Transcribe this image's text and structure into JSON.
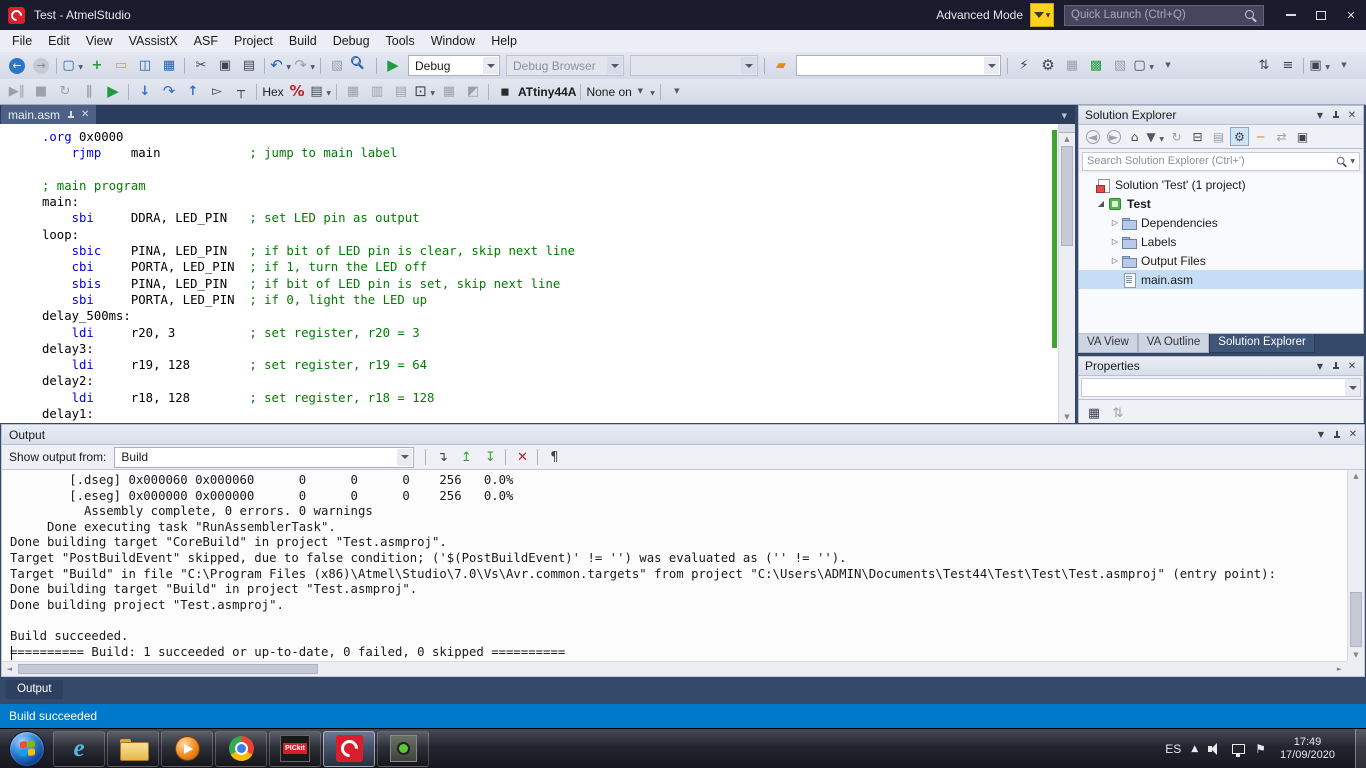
{
  "colors": {
    "statusbar_bg": "#0079CB",
    "keyword": "#0000E6",
    "comment": "#007D00",
    "selection_bg": "#C6DEF5",
    "titlebar_bg": "#1B1B2E",
    "frame_bg": "#35496B"
  },
  "icons": {
    "caret": "▼",
    "caret_up": "▲",
    "close": "✕",
    "left_arrow": "◄",
    "right_arrow": "►"
  },
  "titlebar": {
    "title": "Test - AtmelStudio",
    "advanced_mode_label": "Advanced Mode",
    "quick_launch_placeholder": "Quick Launch (Ctrl+Q)"
  },
  "menubar": {
    "items": [
      "File",
      "Edit",
      "View",
      "VAssistX",
      "ASF",
      "Project",
      "Build",
      "Debug",
      "Tools",
      "Window",
      "Help"
    ]
  },
  "toolbar_standard": {
    "group_a": [
      {
        "n": "nav-back-icon",
        "g": "←",
        "c": "circ"
      },
      {
        "n": "nav-forward-icon",
        "g": "→",
        "c": "circ dim"
      },
      {
        "n": "new-file-icon",
        "g": "▢",
        "c": "sp blue dd"
      },
      {
        "n": "add-item-icon",
        "g": "+",
        "c": "green bold"
      },
      {
        "n": "open-file-icon",
        "g": "▭",
        "c": "gold"
      },
      {
        "n": "save-icon",
        "g": "◫",
        "c": "blue"
      },
      {
        "n": "save-all-icon",
        "g": "▦",
        "c": "blue"
      },
      {
        "n": "cut-icon",
        "g": "✂",
        "c": "sp dark"
      },
      {
        "n": "copy-icon",
        "g": "▣",
        "c": "dark"
      },
      {
        "n": "paste-icon",
        "g": "▤",
        "c": "dark"
      },
      {
        "n": "undo-icon",
        "g": "↶",
        "c": "sp blue dd big"
      },
      {
        "n": "redo-icon",
        "g": "↷",
        "c": "dim dd big"
      },
      {
        "n": "navigate-icon",
        "g": "▧",
        "c": "sp dim"
      },
      {
        "n": "find-icon",
        "g": "",
        "c": "mag blue"
      },
      {
        "n": "start-debugging-icon",
        "g": "▶",
        "c": "sp green big"
      }
    ],
    "debug_config_value": "Debug",
    "debug_browser_value": "Debug Browser",
    "group_b": [
      {
        "n": "profiler-icon",
        "g": "▰",
        "c": "sp orange"
      }
    ],
    "group_c": [
      {
        "n": "device-programming-icon",
        "g": "⚡",
        "c": "sp dark"
      },
      {
        "n": "device-tools-icon",
        "g": "⚙",
        "c": "dark big"
      },
      {
        "n": "show-output-icon",
        "g": "▦",
        "c": "dim"
      },
      {
        "n": "asf-explorer-icon",
        "g": "▩",
        "c": "green"
      },
      {
        "n": "editor-settings-icon",
        "g": "▧",
        "c": "dim"
      },
      {
        "n": "window-layout-icon",
        "g": "▢",
        "c": "dark dd"
      },
      {
        "n": "toolbar-overflow-icon",
        "g": "▼",
        "c": "tiny"
      }
    ],
    "group_d": [
      {
        "n": "sort-lines-icon",
        "g": "⇅",
        "c": "dark"
      },
      {
        "n": "list-members-icon",
        "g": "≡",
        "c": "dark"
      },
      {
        "n": "float-window-icon",
        "g": "▣",
        "c": "sp dark dd"
      },
      {
        "n": "toolbar-options-icon",
        "g": "▼",
        "c": "tiny"
      }
    ]
  },
  "toolbar_debug": {
    "items": [
      {
        "n": "start-debug-break-icon",
        "g": "▶∥",
        "c": "dim"
      },
      {
        "n": "stop-debug-icon",
        "g": "■",
        "c": "dim"
      },
      {
        "n": "restart-debug-icon",
        "g": "↻",
        "c": "dim"
      },
      {
        "n": "break-all-icon",
        "g": "∥",
        "c": "dim bold"
      },
      {
        "n": "continue-icon",
        "g": "▶",
        "c": "green big"
      },
      {
        "n": "step-into-icon",
        "g": "↓",
        "c": "sp step bold"
      },
      {
        "n": "step-over-icon",
        "g": "↷",
        "c": "step big"
      },
      {
        "n": "step-out-icon",
        "g": "↑",
        "c": "step bold"
      },
      {
        "n": "run-to-cursor-icon",
        "g": "▻",
        "c": "dark"
      },
      {
        "n": "show-next-statement-icon",
        "g": "┬",
        "c": "dark"
      },
      {
        "n": "hex-toggle-button",
        "g": "Hex",
        "c": "sp txt"
      },
      {
        "n": "vassistx-icon",
        "g": "%",
        "c": "red bold big"
      },
      {
        "n": "va-options-icon",
        "g": "▤",
        "c": "dark dd"
      },
      {
        "n": "memory-window-icon",
        "g": "▦",
        "c": "sp dim"
      },
      {
        "n": "watch-window-icon",
        "g": "▥",
        "c": "dim"
      },
      {
        "n": "io-view-icon",
        "g": "▤",
        "c": "dim"
      },
      {
        "n": "device-monitor-icon",
        "g": "⊡",
        "c": "dark dd big"
      },
      {
        "n": "register-window-icon",
        "g": "▦",
        "c": "dim"
      },
      {
        "n": "disassembly-window-icon",
        "g": "◩",
        "c": "dim"
      },
      {
        "n": "device-chip-icon",
        "g": "◼",
        "c": "sp chip"
      },
      {
        "n": "device-name-button",
        "g": "ATtiny44A",
        "c": "txt bold"
      },
      {
        "n": "debug-tool-button",
        "g": "None on",
        "c": "sp txt"
      },
      {
        "n": "device-options-icon",
        "g": "▼",
        "c": "tiny dd"
      },
      {
        "n": "toolbar-overflow-icon",
        "g": "▼",
        "c": "sp tiny"
      }
    ]
  },
  "editor": {
    "tab_label": "main.asm",
    "lines": [
      [
        [
          ".org",
          "k"
        ],
        [
          " 0x0000",
          "p"
        ]
      ],
      [
        [
          "    ",
          "p"
        ],
        [
          "rjmp",
          "k"
        ],
        [
          "    main            ",
          "p"
        ],
        [
          "; jump to main label",
          "c"
        ]
      ],
      [],
      [
        [
          "; main program",
          "c"
        ]
      ],
      [
        [
          "main:",
          "p"
        ]
      ],
      [
        [
          "    ",
          "p"
        ],
        [
          "sbi",
          "k"
        ],
        [
          "     DDRA, LED_PIN   ",
          "p"
        ],
        [
          "; set LED pin as output",
          "c"
        ]
      ],
      [
        [
          "loop:",
          "p"
        ]
      ],
      [
        [
          "    ",
          "p"
        ],
        [
          "sbic",
          "k"
        ],
        [
          "    PINA, LED_PIN   ",
          "p"
        ],
        [
          "; if bit of LED pin is clear, skip next line",
          "c"
        ]
      ],
      [
        [
          "    ",
          "p"
        ],
        [
          "cbi",
          "k"
        ],
        [
          "     PORTA, LED_PIN  ",
          "p"
        ],
        [
          "; if 1, turn the LED off",
          "c"
        ]
      ],
      [
        [
          "    ",
          "p"
        ],
        [
          "sbis",
          "k"
        ],
        [
          "    PINA, LED_PIN   ",
          "p"
        ],
        [
          "; if bit of LED pin is set, skip next line",
          "c"
        ]
      ],
      [
        [
          "    ",
          "p"
        ],
        [
          "sbi",
          "k"
        ],
        [
          "     PORTA, LED_PIN  ",
          "p"
        ],
        [
          "; if 0, light the LED up",
          "c"
        ]
      ],
      [
        [
          "delay_500ms:",
          "p"
        ]
      ],
      [
        [
          "    ",
          "p"
        ],
        [
          "ldi",
          "k"
        ],
        [
          "     r20, 3          ",
          "p"
        ],
        [
          "; set register, r20 = 3",
          "c"
        ]
      ],
      [
        [
          "delay3:",
          "p"
        ]
      ],
      [
        [
          "    ",
          "p"
        ],
        [
          "ldi",
          "k"
        ],
        [
          "     r19, 128        ",
          "p"
        ],
        [
          "; set register, r19 = 64",
          "c"
        ]
      ],
      [
        [
          "delay2:",
          "p"
        ]
      ],
      [
        [
          "    ",
          "p"
        ],
        [
          "ldi",
          "k"
        ],
        [
          "     r18, 128        ",
          "p"
        ],
        [
          "; set register, r18 = 128",
          "c"
        ]
      ],
      [
        [
          "delay1:",
          "p"
        ]
      ]
    ]
  },
  "solution_explorer": {
    "title": "Solution Explorer",
    "search_placeholder": "Search Solution Explorer (Ctrl+')",
    "toolbar": [
      {
        "n": "se-back-icon",
        "g": "◄",
        "c": "circ2"
      },
      {
        "n": "se-forward-icon",
        "g": "►",
        "c": "circ2"
      },
      {
        "n": "home-icon",
        "g": "⌂",
        "c": "dark big"
      },
      {
        "n": "scope-filter-icon",
        "g": "▼",
        "c": "tiny dd"
      },
      {
        "n": "refresh-icon",
        "g": "↻",
        "c": "dim"
      },
      {
        "n": "collapse-all-icon",
        "g": "⊟",
        "c": "dark"
      },
      {
        "n": "show-all-files-icon",
        "g": "▤",
        "c": "dim"
      },
      {
        "n": "properties-icon",
        "g": "⚙",
        "c": "dark pressed"
      },
      {
        "n": "preview-selected-icon",
        "g": "─",
        "c": "orange bold"
      },
      {
        "n": "sync-active-document-icon",
        "g": "⇄",
        "c": "dim"
      },
      {
        "n": "solution-options-icon",
        "g": "▣",
        "c": "dark"
      }
    ],
    "tree": [
      {
        "label": "Solution 'Test' (1 project)",
        "cls": "ind1",
        "icon": "solution-icon",
        "exp": ""
      },
      {
        "label": "Test",
        "cls": "ind2 bold",
        "icon": "project-icon",
        "exp": "◢"
      },
      {
        "label": "Dependencies",
        "cls": "ind3",
        "icon": "folder-icon",
        "exp": "▷"
      },
      {
        "label": "Labels",
        "cls": "ind3",
        "icon": "folder-icon",
        "exp": "▷"
      },
      {
        "label": "Output Files",
        "cls": "ind3",
        "icon": "folder-icon",
        "exp": "▷"
      },
      {
        "label": "main.asm",
        "cls": "ind3 selected",
        "icon": "asm-file-icon",
        "exp": ""
      }
    ],
    "tabs": [
      {
        "label": "VA View",
        "name": "tab-va-view",
        "cls": ""
      },
      {
        "label": "VA Outline",
        "name": "tab-va-outline",
        "cls": ""
      },
      {
        "label": "Solution Explorer",
        "name": "tab-solution-explorer",
        "cls": "active"
      }
    ]
  },
  "properties": {
    "title": "Properties",
    "toolbar": [
      {
        "n": "categorized-icon",
        "g": "▦",
        "c": "dark"
      },
      {
        "n": "alphabetical-icon",
        "g": "⇅",
        "c": "dim"
      }
    ]
  },
  "output": {
    "title": "Output",
    "show_output_from_label": "Show output from:",
    "source_value": "Build",
    "toolbar": [
      {
        "n": "find-message-icon",
        "g": "↴",
        "c": "sp dark"
      },
      {
        "n": "prev-message-icon",
        "g": "↥",
        "c": "green2"
      },
      {
        "n": "next-message-icon",
        "g": "↧",
        "c": "green2"
      },
      {
        "n": "clear-all-icon",
        "g": "✕",
        "c": "sp red bold"
      },
      {
        "n": "toggle-word-wrap-icon",
        "g": "¶",
        "c": "sp dark"
      }
    ],
    "console_lines": [
      "        [.dseg] 0x000060 0x000060      0      0      0    256   0.0%",
      "        [.eseg] 0x000000 0x000000      0      0      0    256   0.0%",
      "          Assembly complete, 0 errors. 0 warnings",
      "     Done executing task \"RunAssemblerTask\".",
      "Done building target \"CoreBuild\" in project \"Test.asmproj\".",
      "Target \"PostBuildEvent\" skipped, due to false condition; ('$(PostBuildEvent)' != '') was evaluated as ('' != '').",
      "Target \"Build\" in file \"C:\\Program Files (x86)\\Atmel\\Studio\\7.0\\Vs\\Avr.common.targets\" from project \"C:\\Users\\ADMIN\\Documents\\Test44\\Test\\Test\\Test.asmproj\" (entry point):",
      "Done building target \"Build\" in project \"Test.asmproj\".",
      "Done building project \"Test.asmproj\".",
      "",
      "Build succeeded.",
      "========== Build: 1 succeeded or up-to-date, 0 failed, 0 skipped =========="
    ],
    "bottom_tab_label": "Output"
  },
  "statusbar": {
    "text": "Build succeeded"
  },
  "taskbar": {
    "pickit_label": "PICkit",
    "language": "ES",
    "time": "17:49",
    "date": "17/09/2020"
  }
}
